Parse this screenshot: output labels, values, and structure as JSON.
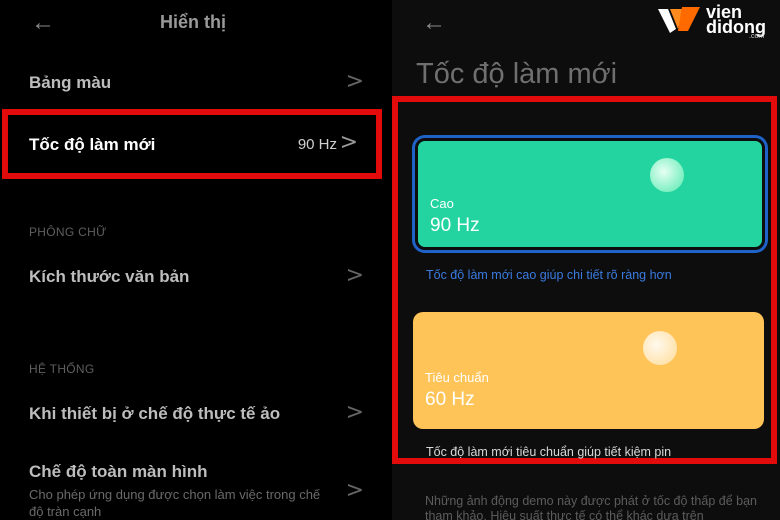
{
  "left": {
    "back_icon": "arrow-left-icon",
    "title": "Hiển thị",
    "items": [
      {
        "label": "Bảng màu"
      },
      {
        "label": "Tốc độ làm mới",
        "value": "90 Hz"
      },
      {
        "label": "Kích thước văn bản"
      },
      {
        "label": "Khi thiết bị ở chế độ thực tế ảo"
      },
      {
        "label": "Chế độ toàn màn hình",
        "sub": "Cho phép ứng dụng được chọn làm việc trong chế độ tràn cạnh"
      }
    ],
    "sections": [
      "PHÔNG CHỮ",
      "HỆ THỐNG"
    ],
    "chevron": ">"
  },
  "right": {
    "back_icon": "arrow-left-icon",
    "title": "Tốc độ làm mới",
    "options": [
      {
        "name": "Cao",
        "value": "90 Hz",
        "description": "Tốc độ làm mới cao giúp chi tiết rõ ràng hơn",
        "selected": true,
        "color": "#24d4a0"
      },
      {
        "name": "Tiêu chuẩn",
        "value": "60 Hz",
        "description": "Tốc độ làm mới tiêu chuẩn giúp tiết kiệm pin",
        "selected": false,
        "color": "#ffc457"
      }
    ],
    "footnote": "Những ảnh động demo này được phát ở tốc độ thấp để bạn tham khảo. Hiệu suất thực tế có thể khác dựa trên"
  },
  "logo": {
    "line1": "vien",
    "line2": "didong",
    "suffix": ".com"
  },
  "colors": {
    "highlight": "#e20b0b",
    "selected_border": "#1f63c8"
  }
}
